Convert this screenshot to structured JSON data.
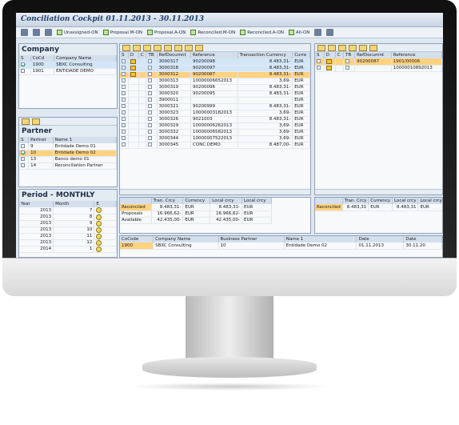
{
  "app": {
    "title": "Conciliation Cockpit 01.11.2013 - 30.11.2013"
  },
  "toolbar": {
    "buttons": [
      "Unassigned-ON",
      "Proposal.M-ON",
      "Proposal.A-ON",
      "Reconciled.M-ON",
      "Reconciled.A-ON",
      "All-ON"
    ]
  },
  "company": {
    "title": "Company",
    "columns": [
      "S",
      "CoCd",
      "Company Name"
    ],
    "rows": [
      [
        "1900",
        "SBXC Consulting"
      ],
      [
        "1901",
        "ENTIDADE DEMO"
      ]
    ]
  },
  "partner": {
    "title": "Partner",
    "columns": [
      "S",
      "Partner",
      "Name 1"
    ],
    "rows": [
      [
        "9",
        "Entidade Demo 01"
      ],
      [
        "10",
        "Entidade Demo 02"
      ],
      [
        "13",
        "Banco demo 01"
      ],
      [
        "14",
        "Reconciliation Partner"
      ]
    ]
  },
  "period": {
    "title": "Period - MONTHLY",
    "columns": [
      "Year",
      "Month",
      "E"
    ],
    "rows": [
      [
        "2013",
        "7"
      ],
      [
        "2013",
        "8"
      ],
      [
        "2013",
        "9"
      ],
      [
        "2013",
        "10"
      ],
      [
        "2013",
        "11"
      ],
      [
        "2013",
        "12"
      ],
      [
        "2014",
        "1"
      ]
    ]
  },
  "docs": {
    "columns": [
      "S",
      "D",
      "C",
      "TB",
      "RefDocumnt",
      "Reference",
      "Transaction Currency",
      "Curre"
    ],
    "rows": [
      [
        "3000317",
        "90200098",
        "8.483,31-",
        "EUR"
      ],
      [
        "3000318",
        "90200097",
        "8.483,31-",
        "EUR"
      ],
      [
        "3000312",
        "90200087",
        "8.483,31-",
        "EUR"
      ],
      [
        "3000313",
        "10000006652013",
        "3,69-",
        "EUR"
      ],
      [
        "3000319",
        "90200096",
        "8.483,31-",
        "EUR"
      ],
      [
        "3000320",
        "90200095",
        "8.483,31-",
        "EUR"
      ],
      [
        "3900011",
        "",
        "",
        "EUR"
      ],
      [
        "3000321",
        "90200999",
        "8.483,31-",
        "EUR"
      ],
      [
        "3000323",
        "10000003182013",
        "3,69-",
        "EUR"
      ],
      [
        "3000326",
        "9021003",
        "8.483,31-",
        "EUR"
      ],
      [
        "3000329",
        "10000006262013",
        "3,69-",
        "EUR"
      ],
      [
        "3000332",
        "10000006582013",
        "3,69-",
        "EUR"
      ],
      [
        "3000344",
        "10000007522013",
        "3,69-",
        "EUR"
      ],
      [
        "3000345",
        "CONC.DEMO",
        "8.487,00-",
        "EUR"
      ]
    ]
  },
  "right_docs": {
    "columns": [
      "S",
      "D",
      "C",
      "TB",
      "RefDocumnt",
      "Reference"
    ],
    "rows": [
      [
        "90200087",
        "1901/00006"
      ],
      [
        "",
        "10000010892013"
      ]
    ]
  },
  "summary": {
    "columns": [
      "",
      "Tran. Crcy",
      "Currency",
      "Local crcy",
      "Local crcy"
    ],
    "rows": [
      [
        "Reconciled",
        "8.483,31-",
        "EUR",
        "8.483,31-",
        "EUR"
      ],
      [
        "Proposals",
        "16.966,62-",
        "EUR",
        "16.966,62-",
        "EUR"
      ],
      [
        "Available",
        "42.435,00-",
        "EUR",
        "42.435,00-",
        "EUR"
      ]
    ]
  },
  "right_summary": {
    "columns": [
      "",
      "Tran. Crcy",
      "Currency",
      "Local crcy",
      "Local crcy"
    ],
    "rows": [
      [
        "Reconciled",
        "8.483,31",
        "EUR",
        "8.483,31",
        "EUR"
      ]
    ]
  },
  "bottom": {
    "columns": [
      "CoCode",
      "Company Name",
      "Business Partner",
      "Name 1",
      "Date",
      "Date"
    ],
    "rows": [
      [
        "1900",
        "SBXC Consulting",
        "10",
        "Entidade Demo 02",
        "01.11.2013",
        "30.11.20"
      ]
    ]
  }
}
